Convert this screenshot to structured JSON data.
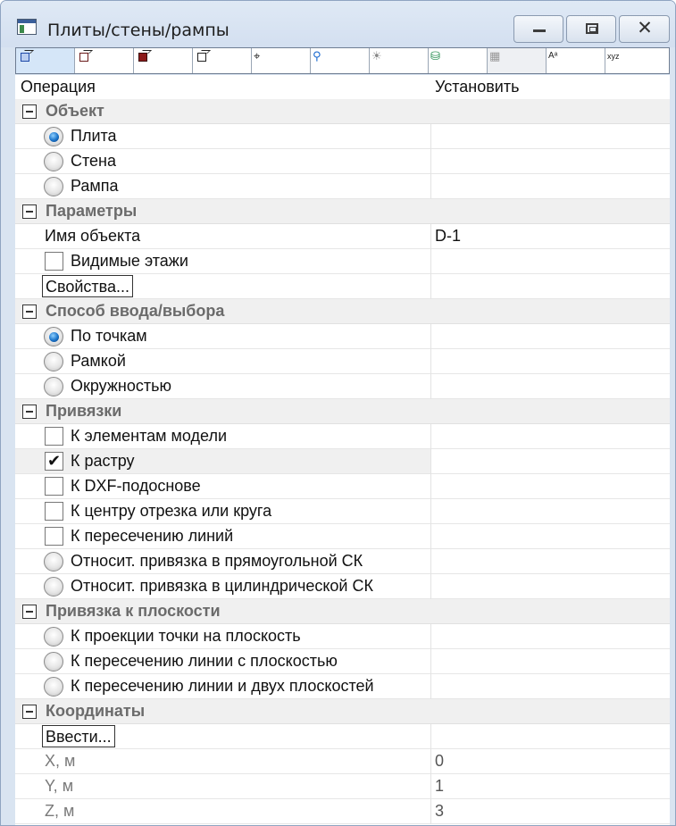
{
  "window": {
    "title": "Плиты/стены/рампы"
  },
  "toolbar": {
    "active": 0,
    "dim": [
      8
    ]
  },
  "header": {
    "operation": "Операция",
    "set": "Установить"
  },
  "sections": [
    {
      "title": "Объект",
      "rows": [
        {
          "type": "radio",
          "label": "Плита",
          "checked": true
        },
        {
          "type": "radio",
          "label": "Стена",
          "checked": false
        },
        {
          "type": "radio",
          "label": "Рампа",
          "checked": false
        }
      ]
    },
    {
      "title": "Параметры",
      "rows": [
        {
          "type": "text",
          "label": "Имя объекта",
          "value": "D-1"
        },
        {
          "type": "check",
          "label": "Видимые этажи",
          "checked": false
        },
        {
          "type": "button",
          "label": "Свойства..."
        }
      ]
    },
    {
      "title": "Способ ввода/выбора",
      "rows": [
        {
          "type": "radio",
          "label": "По точкам",
          "checked": true
        },
        {
          "type": "radio",
          "label": "Рамкой",
          "checked": false
        },
        {
          "type": "radio",
          "label": "Окружностью",
          "checked": false
        }
      ]
    },
    {
      "title": "Привязки",
      "rows": [
        {
          "type": "check",
          "label": "К элементам модели",
          "checked": false
        },
        {
          "type": "check",
          "label": "К растру",
          "checked": true,
          "selected": true
        },
        {
          "type": "check",
          "label": "К DXF-подоснове",
          "checked": false
        },
        {
          "type": "check",
          "label": "К центру отрезка или круга",
          "checked": false
        },
        {
          "type": "check",
          "label": "К пересечению линий",
          "checked": false
        },
        {
          "type": "radio",
          "label": "Относит. привязка в прямоугольной СК",
          "checked": false
        },
        {
          "type": "radio",
          "label": "Относит. привязка в цилиндрической СК",
          "checked": false
        }
      ]
    },
    {
      "title": "Привязка к плоскости",
      "rows": [
        {
          "type": "radio",
          "label": "К проекции точки на плоскость",
          "checked": false
        },
        {
          "type": "radio",
          "label": "К пересечению линии с плоскостью",
          "checked": false
        },
        {
          "type": "radio",
          "label": "К пересечению линии и двух плоскостей",
          "checked": false
        }
      ]
    },
    {
      "title": "Координаты",
      "rows": [
        {
          "type": "button",
          "label": "Ввести..."
        },
        {
          "type": "readonly",
          "label": "X, м",
          "value": "0"
        },
        {
          "type": "readonly",
          "label": "Y, м",
          "value": "1"
        },
        {
          "type": "readonly",
          "label": "Z, м",
          "value": "3"
        }
      ]
    }
  ]
}
